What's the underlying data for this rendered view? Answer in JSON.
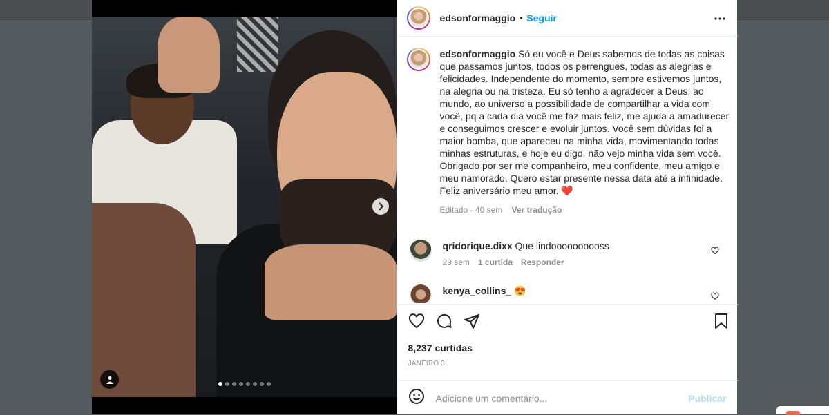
{
  "post": {
    "username": "edsonformaggio",
    "separator": "•",
    "follow_label": "Seguir",
    "caption": "Só eu você e Deus sabemos de todas as coisas que passamos juntos, todos os perrengues, todas as alegrias e felicidades. Independente do momento, sempre estivemos juntos, na alegria ou na tristeza. Eu só tenho a agradecer a Deus, ao mundo, ao universo a possibilidade de compartilhar a vida com você, pq a cada dia você me faz mais feliz, me ajuda a amadurecer e conseguimos crescer e evoluir juntos. Você sem dúvidas foi a maior bomba, que apareceu na minha vida, movimentando todas minhas estruturas, e hoje eu digo, não vejo minha vida sem você. Obrigado por ser me companheiro, meu confidente, meu amigo e meu namorado. Quero estar presente nessa data até a infinidade. Feliz aniversário meu amor. ❤️",
    "edited": "Editado · 40 sem",
    "see_translation": "Ver tradução",
    "likes": "8,237 curtidas",
    "date": "JANEIRO 3"
  },
  "carousel": {
    "slide_count": 8,
    "active_index": 0
  },
  "comments": [
    {
      "username": "qridorique.dixx",
      "text": "Que lindoooooooooss",
      "time": "29 sem",
      "likes": "1 curtida",
      "reply": "Responder"
    },
    {
      "username": "kenya_collins_",
      "text": "😍"
    }
  ],
  "add_comment": {
    "placeholder": "Adicione um comentário...",
    "publish": "Publicar"
  },
  "colors": {
    "accent": "#0095f6",
    "publish_disabled": "#b2dffc",
    "muted": "#8e8e8e",
    "heart": "#ed4956"
  },
  "icons": [
    "more-icon",
    "heart-icon",
    "comment-icon",
    "share-icon",
    "save-icon",
    "emoji-icon",
    "chevron-right-icon",
    "user-tag-icon"
  ]
}
